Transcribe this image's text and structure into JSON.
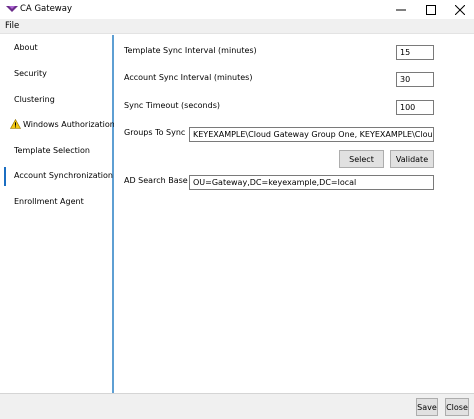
{
  "window": {
    "title": "CA Gateway",
    "accent_color": "#5e9fd3"
  },
  "menu": {
    "file_label": "File"
  },
  "sidebar": {
    "items": [
      {
        "label": "About"
      },
      {
        "label": "Security"
      },
      {
        "label": "Clustering"
      },
      {
        "label": "Windows Authorization",
        "icon": "warning-icon"
      },
      {
        "label": "Template Selection"
      },
      {
        "label": "Account Synchronization",
        "selected": true
      },
      {
        "label": "Enrollment Agent"
      }
    ]
  },
  "form": {
    "template_sync": {
      "label": "Template Sync Interval (minutes)",
      "value": "15"
    },
    "account_sync": {
      "label": "Account Sync Interval (minutes)",
      "value": "30"
    },
    "sync_timeout": {
      "label": "Sync Timeout (seconds)",
      "value": "100"
    },
    "groups_to_sync": {
      "label": "Groups To Sync",
      "value": "KEYEXAMPLE\\Cloud Gateway Group One, KEYEXAMPLE\\Cloud Gateway G"
    },
    "select_label": "Select",
    "validate_label": "Validate",
    "ad_search_base": {
      "label": "AD Search Base",
      "value": "OU=Gateway,DC=keyexample,DC=local"
    }
  },
  "footer": {
    "save_label": "Save",
    "close_label": "Close"
  }
}
